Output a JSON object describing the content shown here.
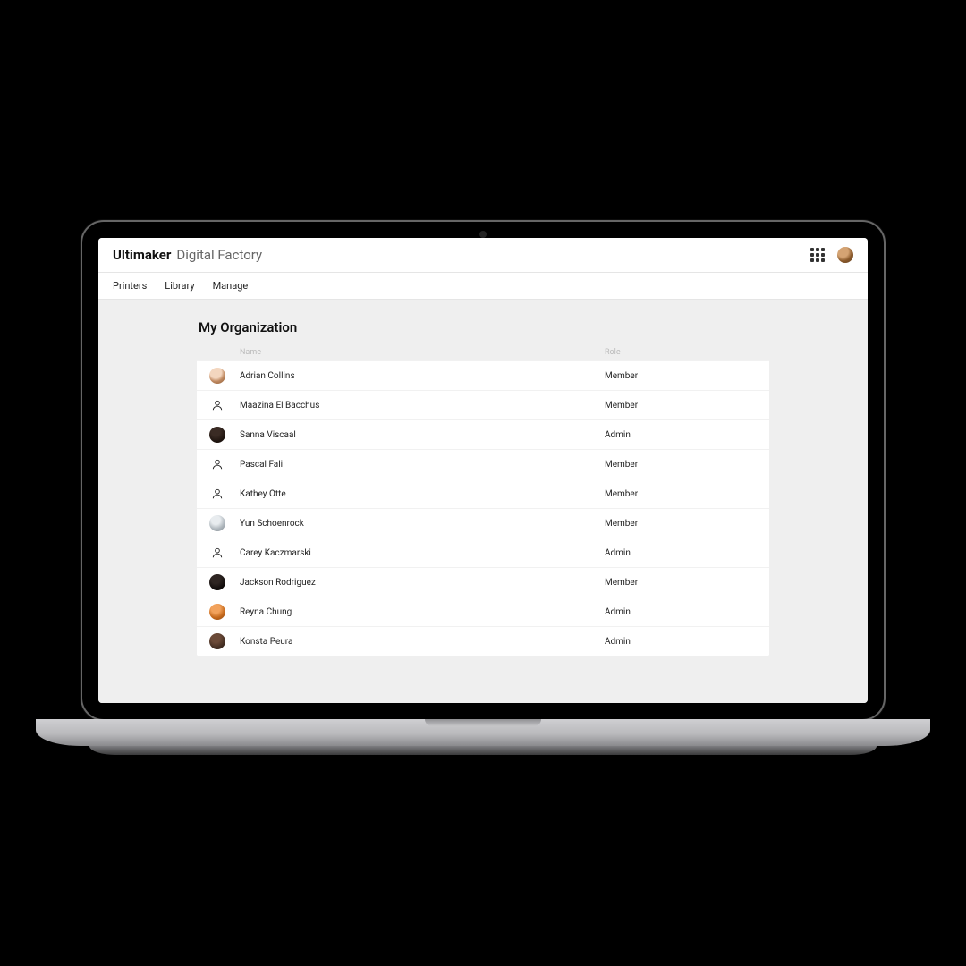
{
  "header": {
    "brand_strong": "Ultimaker",
    "brand_light": "Digital Factory"
  },
  "nav": {
    "items": [
      {
        "label": "Printers"
      },
      {
        "label": "Library"
      },
      {
        "label": "Manage"
      }
    ]
  },
  "page": {
    "title": "My Organization",
    "columns": {
      "name": "Name",
      "role": "Role"
    },
    "members": [
      {
        "name": "Adrian Collins",
        "role": "Member",
        "avatar": "photo1",
        "avatar_label": "photo"
      },
      {
        "name": "Maazina El Bacchus",
        "role": "Member",
        "avatar": "blank",
        "avatar_label": "default"
      },
      {
        "name": "Sanna Viscaal",
        "role": "Admin",
        "avatar": "photo2",
        "avatar_label": "photo"
      },
      {
        "name": "Pascal Fali",
        "role": "Member",
        "avatar": "blank",
        "avatar_label": "default"
      },
      {
        "name": "Kathey Otte",
        "role": "Member",
        "avatar": "blank",
        "avatar_label": "default"
      },
      {
        "name": "Yun Schoenrock",
        "role": "Member",
        "avatar": "photo3",
        "avatar_label": "photo"
      },
      {
        "name": "Carey Kaczmarski",
        "role": "Admin",
        "avatar": "blank",
        "avatar_label": "default"
      },
      {
        "name": "Jackson Rodriguez",
        "role": "Member",
        "avatar": "photo4",
        "avatar_label": "photo"
      },
      {
        "name": "Reyna Chung",
        "role": "Admin",
        "avatar": "photo5",
        "avatar_label": "photo"
      },
      {
        "name": "Konsta Peura",
        "role": "Admin",
        "avatar": "photo6",
        "avatar_label": "photo"
      }
    ]
  }
}
